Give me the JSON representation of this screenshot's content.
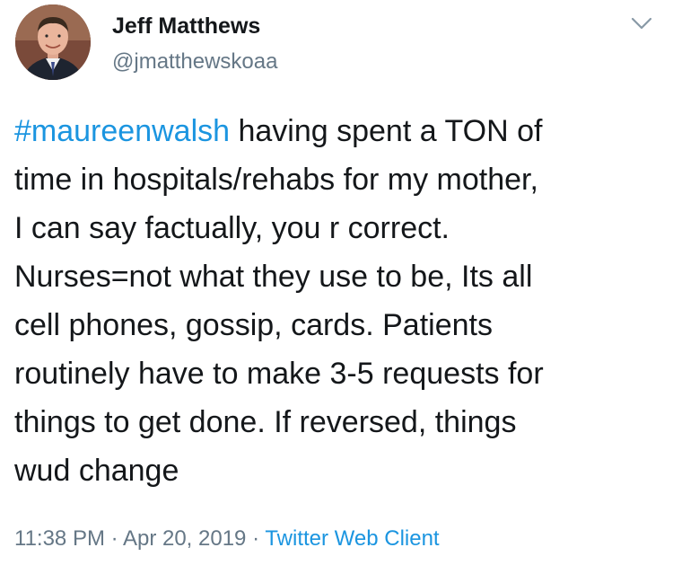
{
  "tweet": {
    "author_name": "Jeff Matthews",
    "author_handle": "@jmatthewskoaa",
    "hashtag": "#maureenwalsh",
    "lines": [
      " having spent a TON of",
      "time in hospitals/rehabs for my mother,",
      "I can say factually, you r correct.",
      "Nurses=not what they use to be, Its all",
      "cell phones, gossip, cards. Patients",
      "routinely have to make 3-5 requests for",
      "things to get done. If reversed, things",
      "wud change"
    ],
    "time": "11:38 PM",
    "date": "Apr 20, 2019",
    "separator": " · ",
    "source": "Twitter Web Client"
  },
  "icons": {
    "menu": "chevron-down-icon",
    "avatar": "avatar"
  },
  "colors": {
    "text": "#14171a",
    "secondary": "#657786",
    "link": "#1b95e0",
    "background": "#ffffff"
  }
}
